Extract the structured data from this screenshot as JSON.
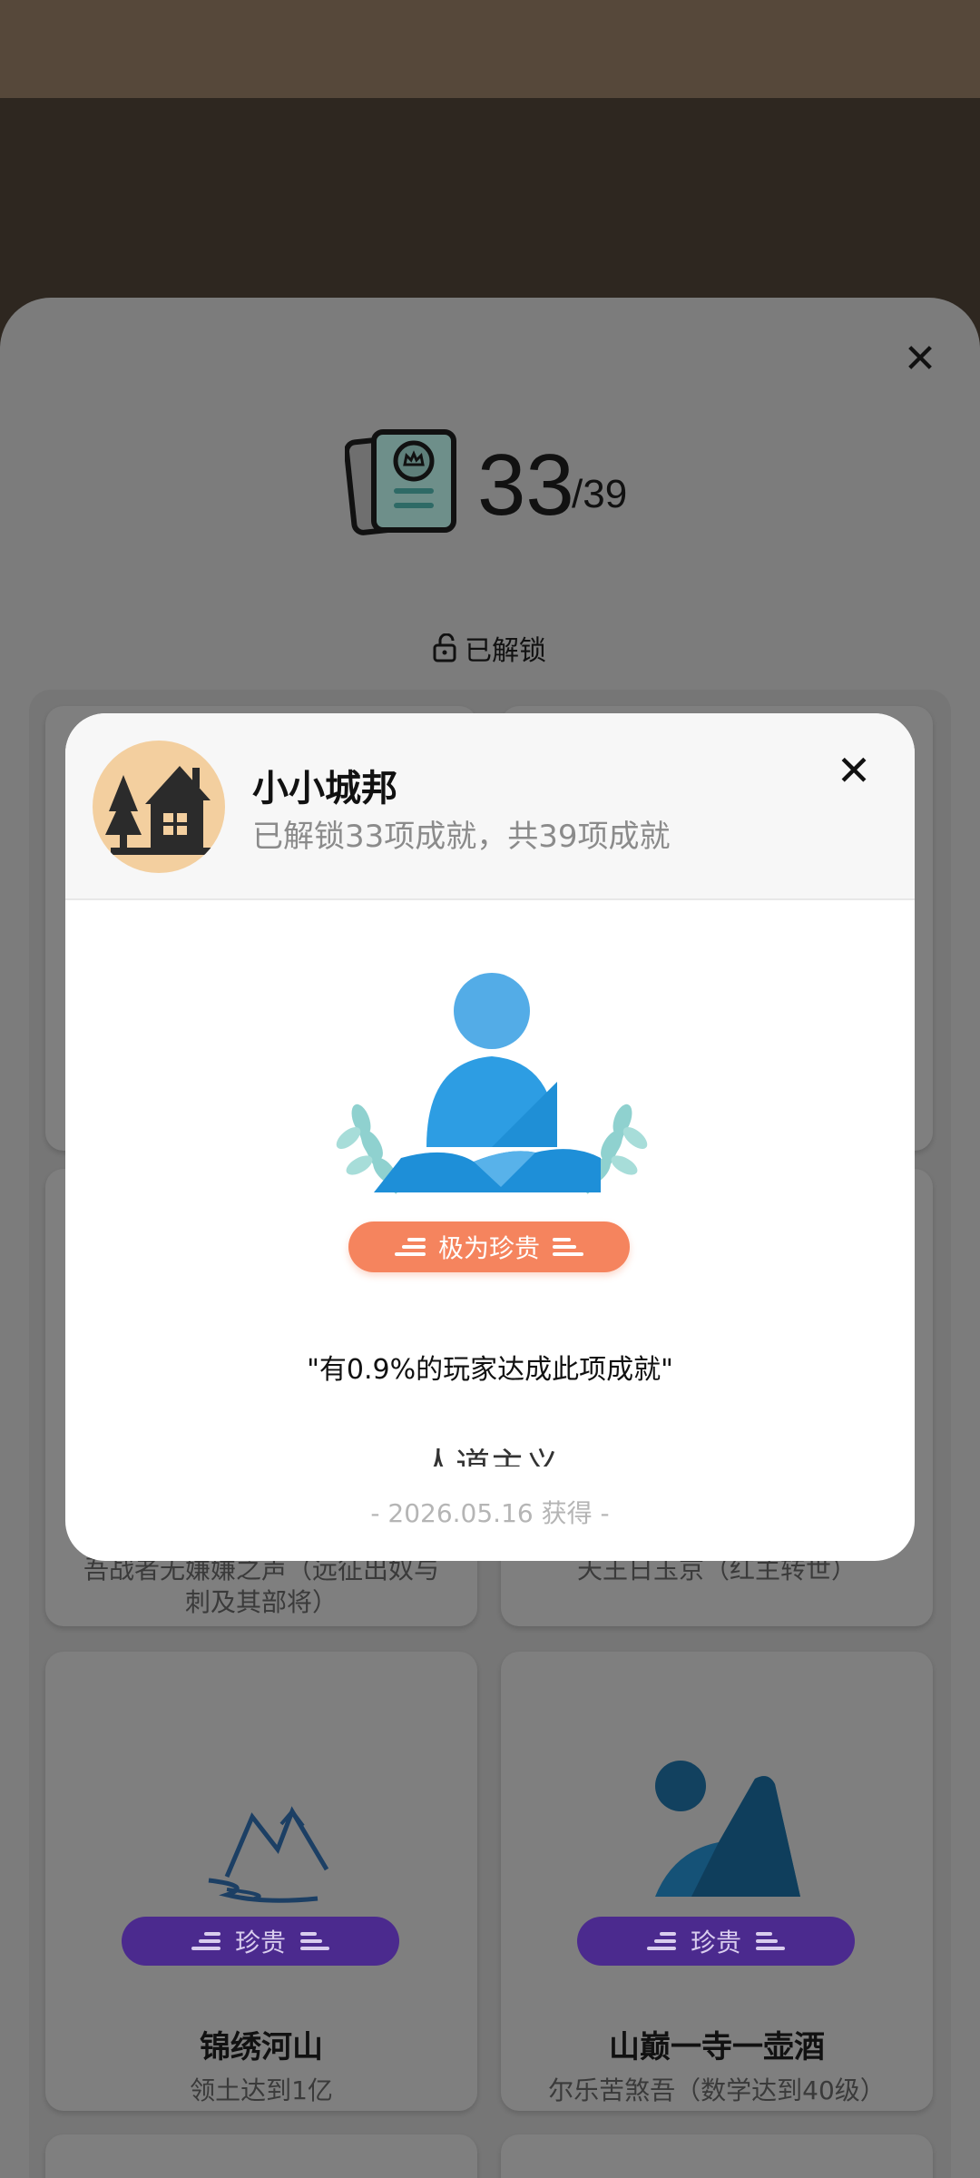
{
  "counter": {
    "unlocked": "33",
    "total": "/39"
  },
  "filter": {
    "label": "已解锁"
  },
  "cards_behind": [
    {
      "desc_line1": "吾战者无嫌嫌之声（远征出奴与",
      "desc_line2": "刺及其部将）"
    },
    {
      "desc_line1": "天王日玉京（红主转世）"
    }
  ],
  "cards": [
    {
      "title": "锦绣河山",
      "desc": "领土达到1亿",
      "rarity": "珍贵",
      "icon": "mountain-river-icon"
    },
    {
      "title": "山巅一寺一壶酒",
      "desc": "尔乐苦煞吾（数学达到40级）",
      "rarity": "珍贵",
      "icon": "mountain-sun-icon"
    }
  ],
  "modal": {
    "game_name": "小小城邦",
    "game_subtitle": "已解锁33项成就，共39项成就",
    "game_icon": "house-tree-icon",
    "badge_icon": "person-laurel-icon",
    "rarity": "极为珍贵",
    "stat": "\"有0.9%的玩家达成此项成就\"",
    "achievement_name": "人道主义",
    "achievement_date": "- 2026.05.16 获得 -"
  },
  "colors": {
    "rare_orange": "#f5845e",
    "precious_purple": "#4b2a8e",
    "badge_blue": "#2d9de3",
    "laurel_teal": "#8fd1cf"
  }
}
